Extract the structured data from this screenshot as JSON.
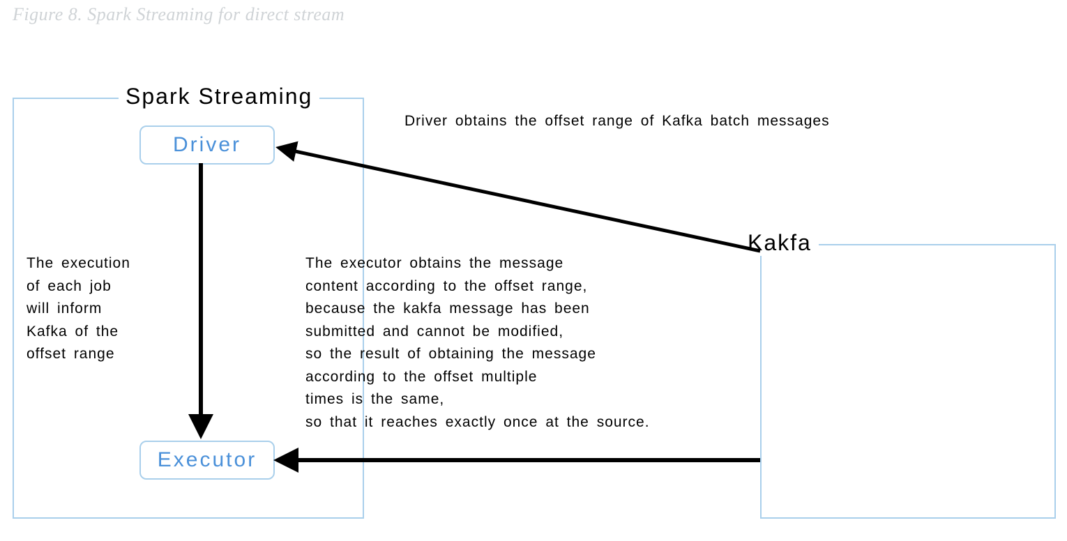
{
  "caption": "Figure 8. Spark Streaming for direct stream",
  "panels": {
    "spark": {
      "title": "Spark Streaming"
    },
    "kafka": {
      "title": "Kakfa"
    }
  },
  "nodes": {
    "driver": "Driver",
    "executor": "Executor"
  },
  "labels": {
    "top": "Driver obtains the offset range of Kafka batch messages",
    "left": "The execution\nof each job\nwill inform\nKafka of the\noffset range",
    "middle": "The executor obtains the message\ncontent according to the offset range,\nbecause the kakfa message has been\nsubmitted and cannot be modified,\nso the result of obtaining the message\naccording to the offset multiple\n times is the same,\nso that it reaches exactly once at the source."
  },
  "arrows": [
    {
      "name": "kafka-to-driver",
      "from": "kafka-panel",
      "to": "driver-node"
    },
    {
      "name": "driver-to-executor",
      "from": "driver-node",
      "to": "executor-node"
    },
    {
      "name": "kafka-to-executor",
      "from": "kafka-panel",
      "to": "executor-node"
    }
  ]
}
